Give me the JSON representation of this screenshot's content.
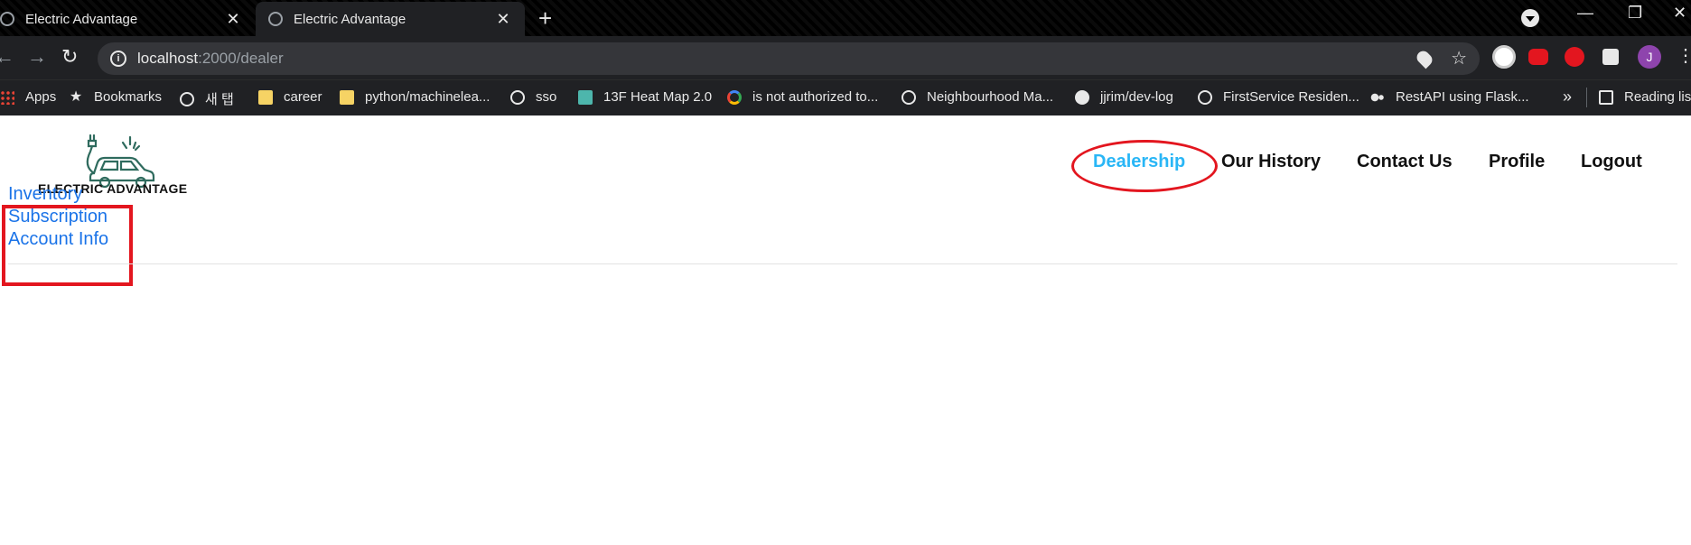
{
  "browser": {
    "tabs": [
      {
        "title": "Electric Advantage",
        "active": false
      },
      {
        "title": "Electric Advantage",
        "active": true
      }
    ],
    "close_glyph": "✕",
    "new_tab_glyph": "+",
    "window_controls": [
      "—",
      "❐",
      "✕"
    ],
    "url_host": "localhost",
    "url_path": ":2000/dealer",
    "bookmarks": [
      {
        "label": "Apps",
        "icon": "apps-icon"
      },
      {
        "label": "Bookmarks",
        "icon": "star-icon"
      },
      {
        "label": "새 탭",
        "icon": "globe-icon"
      },
      {
        "label": "career",
        "icon": "folder-icon"
      },
      {
        "label": "python/machinelea...",
        "icon": "folder-icon"
      },
      {
        "label": "sso",
        "icon": "globe-icon"
      },
      {
        "label": "13F Heat Map 2.0",
        "icon": "folder-icon"
      },
      {
        "label": "is not authorized to...",
        "icon": "google-icon"
      },
      {
        "label": "Neighbourhood Ma...",
        "icon": "globe-icon"
      },
      {
        "label": "jjrim/dev-log",
        "icon": "github-icon"
      },
      {
        "label": "FirstService Residen...",
        "icon": "globe-icon"
      },
      {
        "label": "RestAPI using Flask...",
        "icon": "medium-icon"
      }
    ],
    "more_glyph": "»",
    "reading_list": "Reading list",
    "profile_initial": "J"
  },
  "site": {
    "logo_text": "ELECTRIC ADVANTAGE",
    "nav": [
      {
        "label": "Dealership",
        "active": true
      },
      {
        "label": "Our History",
        "active": false
      },
      {
        "label": "Contact Us",
        "active": false
      },
      {
        "label": "Profile",
        "active": false
      },
      {
        "label": "Logout",
        "active": false
      }
    ],
    "sidebar": [
      {
        "label": "Inventory"
      },
      {
        "label": "Subscription"
      },
      {
        "label": "Account Info"
      }
    ]
  },
  "colors": {
    "active_nav": "#29b6f6",
    "link": "#1a73e8",
    "annotation": "#e3161f"
  }
}
